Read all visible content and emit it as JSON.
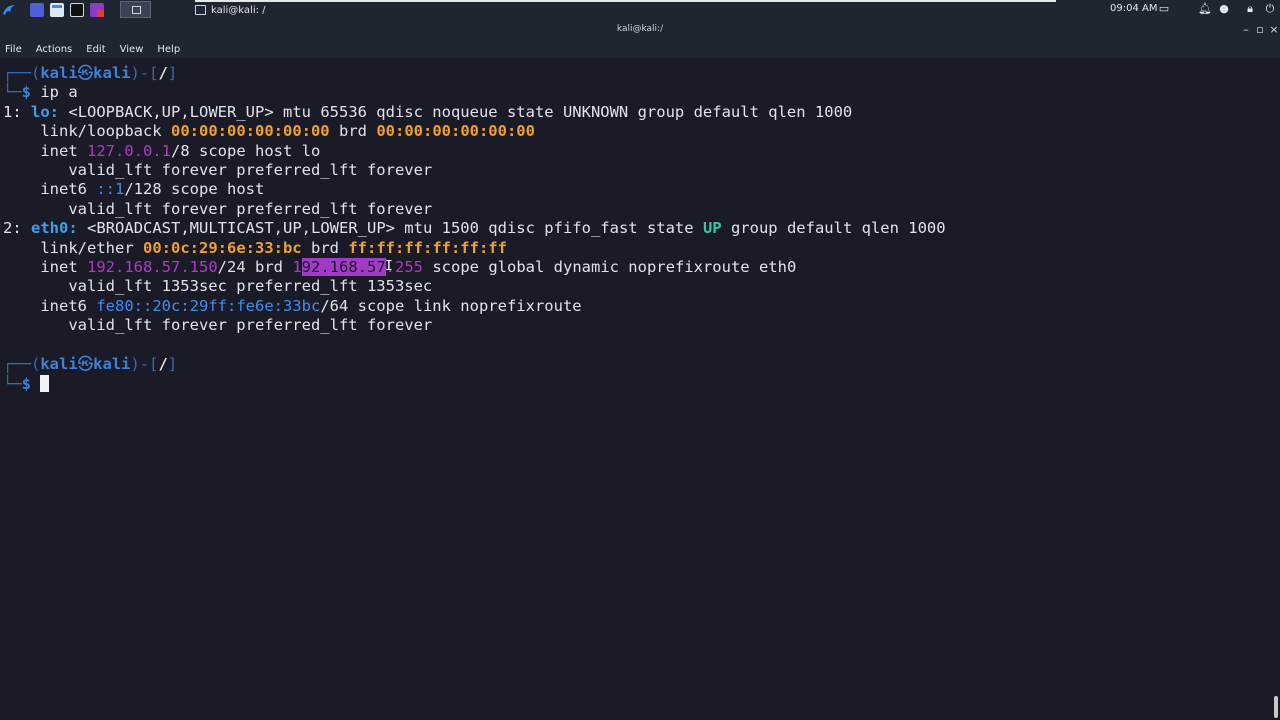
{
  "panel": {
    "task_title": "kali@kali: /",
    "clock": "09:04 AM",
    "icons": [
      "kali-dragon-icon",
      "desktop-icon",
      "file-manager-icon",
      "terminal-icon",
      "settings-icon"
    ],
    "tray_icons": [
      "screen-icon",
      "bell-icon",
      "shield-icon",
      "lock-icon",
      "power-icon"
    ]
  },
  "window": {
    "title": "kali@kali:/"
  },
  "menu": {
    "items": [
      "File",
      "Actions",
      "Edit",
      "View",
      "Help"
    ]
  },
  "terminal": {
    "prompt1": {
      "user": "kali",
      "at": "㉿",
      "host": "kali",
      "path": "/",
      "command": "ip a"
    },
    "lo": {
      "index": "1:",
      "name": "lo:",
      "flags": "<LOOPBACK,UP,LOWER_UP> mtu 65536 qdisc noqueue state UNKNOWN group default qlen 1000",
      "link_label": "link/loopback",
      "mac": "00:00:00:00:00:00",
      "brd_label": "brd",
      "brd": "00:00:00:00:00:00",
      "inet_label": "inet",
      "inet": "127.0.0.1",
      "inet_rest": "/8 scope host lo",
      "valid1": "valid_lft forever preferred_lft forever",
      "inet6_label": "inet6",
      "inet6": "::1",
      "inet6_rest": "/128 scope host",
      "valid2": "valid_lft forever preferred_lft forever"
    },
    "eth0": {
      "index": "2:",
      "name": "eth0:",
      "flags_a": "<BROADCAST,MULTICAST,UP,LOWER_UP> mtu 1500 qdisc pfifo_fast state",
      "state": "UP",
      "flags_b": "group default qlen 1000",
      "link_label": "link/ether",
      "mac": "00:0c:29:6e:33:bc",
      "brd_label": "brd",
      "brd": "ff:ff:ff:ff:ff:ff",
      "inet_label": "inet",
      "inet": "192.168.57.150",
      "inet_mid": "/24 brd",
      "brd_ip_a": "1",
      "brd_ip_sel": "92.168.57",
      "brd_ip_b": ".255",
      "inet_rest": "scope global dynamic noprefixroute eth0",
      "valid1": "valid_lft 1353sec preferred_lft 1353sec",
      "inet6_label": "inet6",
      "inet6": "fe80::20c:29ff:fe6e:33bc",
      "inet6_rest": "/64 scope link noprefixroute",
      "valid2": "valid_lft forever preferred_lft forever"
    },
    "prompt2": {
      "user": "kali",
      "at": "㉿",
      "host": "kali",
      "path": "/"
    }
  }
}
